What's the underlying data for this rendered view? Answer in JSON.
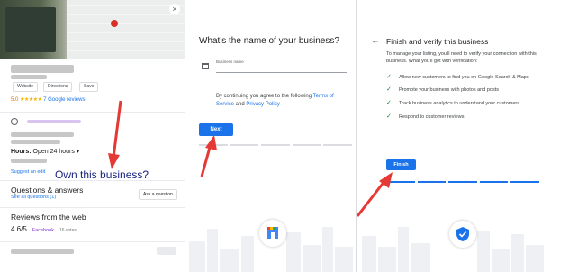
{
  "listing": {
    "buttons": {
      "website": "Website",
      "directions": "Directions",
      "save": "Save"
    },
    "rating": "5.0",
    "stars": "★★★★★",
    "reviews": "7 Google reviews",
    "hours_label": "Hours:",
    "hours_value": "Open 24 hours",
    "hours_caret": "▾",
    "suggest_edit": "Suggest an edit",
    "own_business": "Own this business?",
    "qa_title": "Questions & answers",
    "see_all_questions": "See all questions (1)",
    "ask_question": "Ask a question",
    "reviews_web_title": "Reviews from the web",
    "web_rating": "4.6/5",
    "web_source": "Facebook",
    "web_votes": "16 votes",
    "close_icon": "×"
  },
  "step_name": {
    "title": "What's the name of your business?",
    "field_label": "Business name",
    "field_value": "",
    "agree_text": "By continuing you agree to the following ",
    "terms_link": "Terms of Service",
    "and_text": " and ",
    "privacy_link": "Privacy Policy",
    "next_button": "Next"
  },
  "step_verify": {
    "back_icon": "←",
    "title": "Finish and verify this business",
    "intro": "To manage your listing, you'll need to verify your connection with this business. What you'll get with verification:",
    "check_glyph": "✓",
    "benefits": [
      "Allow new customers to find you on Google Search & Maps",
      "Promote your business with photos and posts",
      "Track business analytics to understand your customers",
      "Respond to customer reviews"
    ],
    "finish_button": "Finish"
  },
  "colors": {
    "accent_blue": "#1a73e8",
    "arrow_red": "#e53935",
    "check_green": "#188038",
    "star_yellow": "#f4b400"
  }
}
